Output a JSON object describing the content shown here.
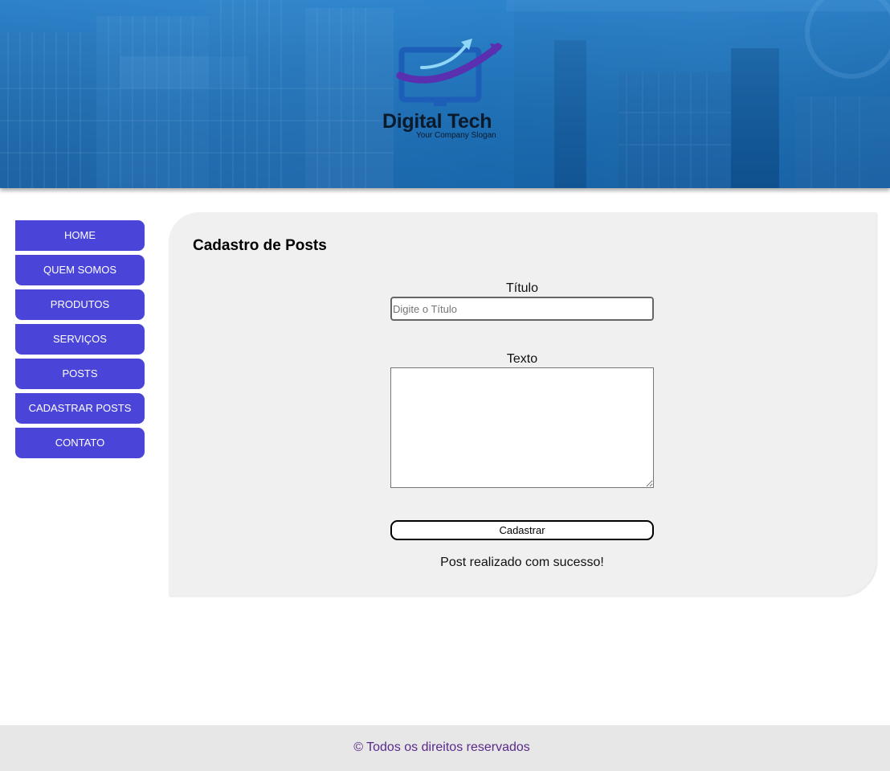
{
  "header": {
    "logo_title": "Digital Tech",
    "logo_slogan": "Your Company Slogan",
    "logo_icon": "monitor-arrow-logo-icon",
    "banner_image": "shipping-containers-banner"
  },
  "nav": {
    "items": [
      {
        "label": "HOME"
      },
      {
        "label": "QUEM SOMOS"
      },
      {
        "label": "PRODUTOS"
      },
      {
        "label": "SERVIÇOS"
      },
      {
        "label": "POSTS"
      },
      {
        "label": "CADASTRAR POSTS"
      },
      {
        "label": "CONTATO"
      }
    ]
  },
  "form": {
    "title": "Cadastro de Posts",
    "title_label": "Título",
    "title_placeholder": "Digite o Título",
    "title_value": "",
    "text_label": "Texto",
    "text_value": "",
    "submit_label": "Cadastrar",
    "status_message": "Post realizado com sucesso!"
  },
  "footer": {
    "text": "© Todos os direitos reservados"
  },
  "colors": {
    "nav_bg": "#4a45d8",
    "panel_bg": "#f0f0f0",
    "footer_bg": "#e7e7e7",
    "footer_text": "#5a2a8a",
    "header_blue": "#1f74bc"
  }
}
